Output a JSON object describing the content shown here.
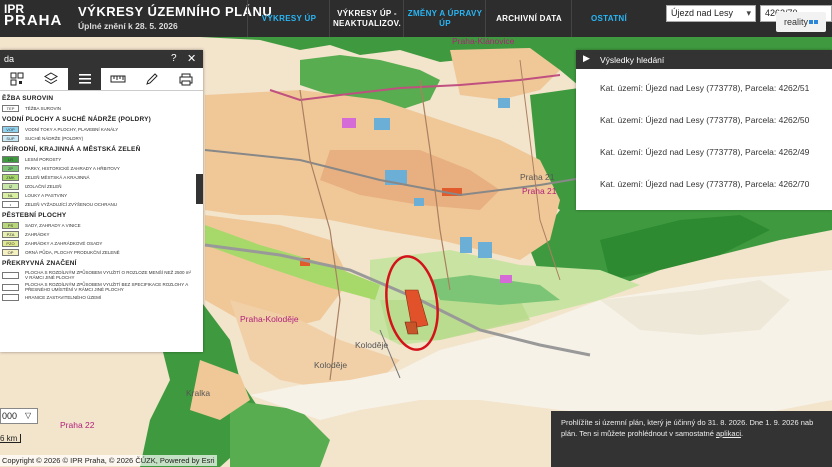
{
  "header": {
    "logo_line1": "IPR",
    "logo_line2": "PRAHA",
    "title": "VÝKRESY ÚZEMNÍHO PLÁNU",
    "subtitle": "Úplné znění k 28. 5. 2026",
    "nav": [
      {
        "label": "VÝKRESY ÚP",
        "accent": true
      },
      {
        "label": "VÝKRESY ÚP - NEAKTUALIZOV.",
        "accent": false
      },
      {
        "label": "ZMĚNY A ÚPRAVY ÚP",
        "accent": true
      },
      {
        "label": "ARCHIVNÍ DATA",
        "accent": false
      },
      {
        "label": "OSTATNÍ",
        "accent": true
      }
    ],
    "territory_select": "Újezd nad Lesy",
    "parcel_select": "4262/70",
    "reality_badge": "reality"
  },
  "legend": {
    "title": "da",
    "help": "?",
    "close": "✕",
    "groups": [
      {
        "title": "ĚŽBA SUROVIN",
        "items": [
          {
            "code": "TEP",
            "label": "TĚŽBA SUROVIN",
            "color": "#ffffff"
          }
        ]
      },
      {
        "title": "VODNÍ PLOCHY A SUCHÉ NÁDRŽE (POLDRY)",
        "items": [
          {
            "code": "VOP",
            "label": "VODNÍ TOKY A PLOCHY, PLAVEBNÍ KANÁLY",
            "color": "#8fd3f0"
          },
          {
            "code": "SUP",
            "label": "SUCHÉ NÁDRŽE (POLDRY)",
            "color": "#c8ebf7"
          }
        ]
      },
      {
        "title": "PŘÍRODNÍ, KRAJINNÁ A MĚSTSKÁ ZELEŇ",
        "items": [
          {
            "code": "LR",
            "label": "LESNÍ POROSTY",
            "color": "#3e9a3e"
          },
          {
            "code": "ZP",
            "label": "PARKY, HISTORICKÉ ZAHRADY A HŘBITOVY",
            "color": "#7cc576"
          },
          {
            "code": "ZMK",
            "label": "ZELEŇ MĚSTSKÁ A KRAJINNÁ",
            "color": "#a6d96a"
          },
          {
            "code": "IZ",
            "label": "IZOLAČNÍ ZELEŇ",
            "color": "#c7e9a8"
          },
          {
            "code": "NL",
            "label": "LOUKY A PASTVINY",
            "color": "#d9f0a3"
          },
          {
            "code": "•",
            "label": "ZELEŇ VYŽADUJÍCÍ ZVÝŠENOU OCHRANU",
            "color": "#ffffff"
          }
        ]
      },
      {
        "title": "PĚSTEBNÍ PLOCHY",
        "items": [
          {
            "code": "PS",
            "label": "SADY, ZAHRADY A VINICE",
            "color": "#b8d67a"
          },
          {
            "code": "PZA",
            "label": "ZAHRÁDKY",
            "color": "#e8f0b0"
          },
          {
            "code": "PZO",
            "label": "ZAHRÁDKY A ZAHRÁDKOVÉ OSADY",
            "color": "#e0e890"
          },
          {
            "code": "OP",
            "label": "ORNÁ PŮDA, PLOCHY PRODUKČNÍ ZELENĚ",
            "color": "#f5f0c0"
          }
        ]
      },
      {
        "title": "PŘEKRYVNÁ ZNAČENÍ",
        "items": [
          {
            "code": "",
            "label": "PLOCHA S ROZDÍLNÝM ZPŮSOBEM VYUŽITÍ O ROZLOZE MENŠÍ NEŽ 2500 m² V RÁMCI JINÉ PLOCHY",
            "color": "#ffffff"
          },
          {
            "code": "",
            "label": "PLOCHA S ROZDÍLNÝM ZPŮSOBEM VYUŽITÍ BEZ SPECIFIKACE ROZLOHY A PŘESNÉHO UMÍSTĚNÍ V RÁMCI JINÉ PLOCHY",
            "color": "#ffffff"
          },
          {
            "code": "",
            "label": "HRANICE ZASTAVITELNÉHO ÚZEMÍ",
            "color": "#ffffff"
          }
        ]
      }
    ]
  },
  "results": {
    "title": "Výsledky hledání",
    "items": [
      "Kat. území: Újezd nad Lesy (773778), Parcela: 4262/51",
      "Kat. území: Újezd nad Lesy (773778), Parcela: 4262/50",
      "Kat. území: Újezd nad Lesy (773778), Parcela: 4262/49",
      "Kat. území: Újezd nad Lesy (773778), Parcela: 4262/70"
    ]
  },
  "map": {
    "labels": {
      "klanovice": "Praha-Klánovice",
      "praha21a": "Praha 21",
      "praha21b": "Praha 21",
      "kolodeje_district": "Praha-Koloděje",
      "kolodeje_town": "Koloděje",
      "kolodeje_small": "Koloděje",
      "praha22": "Praha 22",
      "kralka": "Kralka"
    },
    "scale": "000",
    "scale_bar": "6 km",
    "attribution": "Copyright © 2026 © IPR Praha, © 2026 ČÚZK, Powered by Esri"
  },
  "notice": {
    "text1": "Prohlížíte si územní plán, který je účinný do 31. 8. 2026. Dne 1. 9. 2026 nab",
    "text2": "plán. Ten si můžete prohlédnout v samostatné",
    "link": "aplikaci",
    "dot": "."
  }
}
